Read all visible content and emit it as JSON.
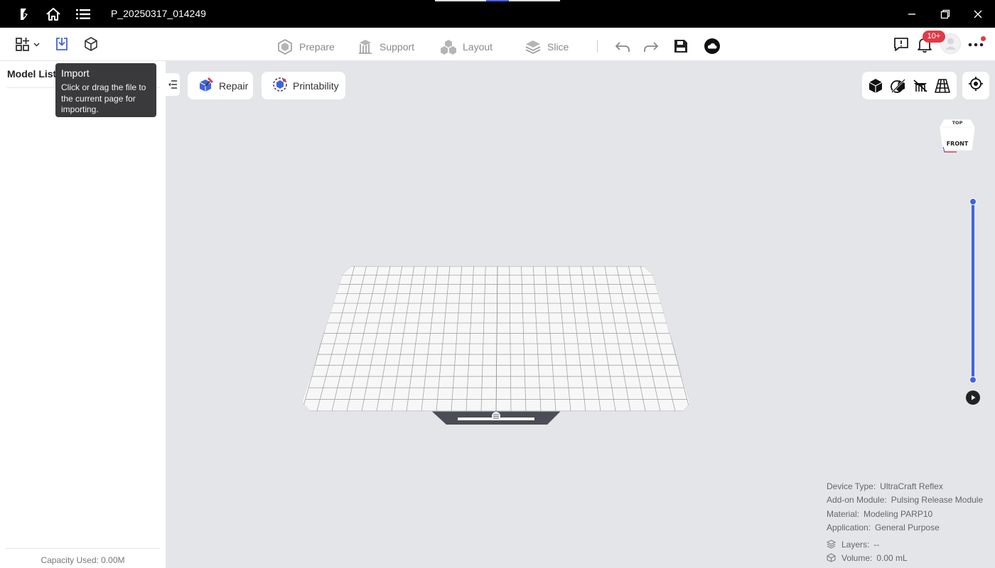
{
  "titlebar": {
    "document_title": "P_20250317_014249",
    "icons": [
      "app-logo-icon",
      "home-icon",
      "menu-list-icon"
    ],
    "window_controls": [
      "minimize-icon",
      "restore-icon",
      "close-icon"
    ]
  },
  "toolbar": {
    "left_icons": [
      "apps-grid-icon",
      "import-icon",
      "model-cube-icon"
    ],
    "steps": [
      {
        "label": "Prepare",
        "icon": "prepare-icon"
      },
      {
        "label": "Support",
        "icon": "support-icon"
      },
      {
        "label": "Layout",
        "icon": "layout-icon"
      },
      {
        "label": "Slice",
        "icon": "slice-icon"
      }
    ],
    "actions": [
      "undo-icon",
      "redo-icon",
      "save-icon",
      "cloud-icon"
    ],
    "notification_badge": "10+",
    "right_icons": [
      "feedback-icon",
      "bell-icon",
      "avatar",
      "more-icon"
    ]
  },
  "sidebar": {
    "title": "Model List",
    "capacity": "Capacity Used: 0.00M"
  },
  "tooltip": {
    "title": "Import",
    "body": "Click or drag the file to the current page for importing."
  },
  "viewport": {
    "repair_label": "Repair",
    "printability_label": "Printability",
    "view_icons": [
      "solid-view-icon",
      "xray-view-icon",
      "hide-support-icon",
      "grid-view-icon"
    ],
    "locate_icon": "locate-icon",
    "view_cube": {
      "top": "TOP",
      "front": "FRONT"
    },
    "layer_slider": {
      "min": 0,
      "max": 1,
      "value_top": 1,
      "value_bottom": 0
    }
  },
  "info": {
    "device_type_key": "Device Type:",
    "device_type_val": "UltraCraft Reflex",
    "addon_key": "Add-on Module:",
    "addon_val": "Pulsing Release Module",
    "material_key": "Material:",
    "material_val": "Modeling PARP10",
    "application_key": "Application:",
    "application_val": "General Purpose",
    "layers_key": "Layers:",
    "layers_val": "--",
    "volume_key": "Volume:",
    "volume_val": "0.00 mL"
  },
  "colors": {
    "accent": "#3f63e0",
    "badge": "#e03a48",
    "titlebar": "#000000",
    "canvas": "#e4e5e8"
  }
}
